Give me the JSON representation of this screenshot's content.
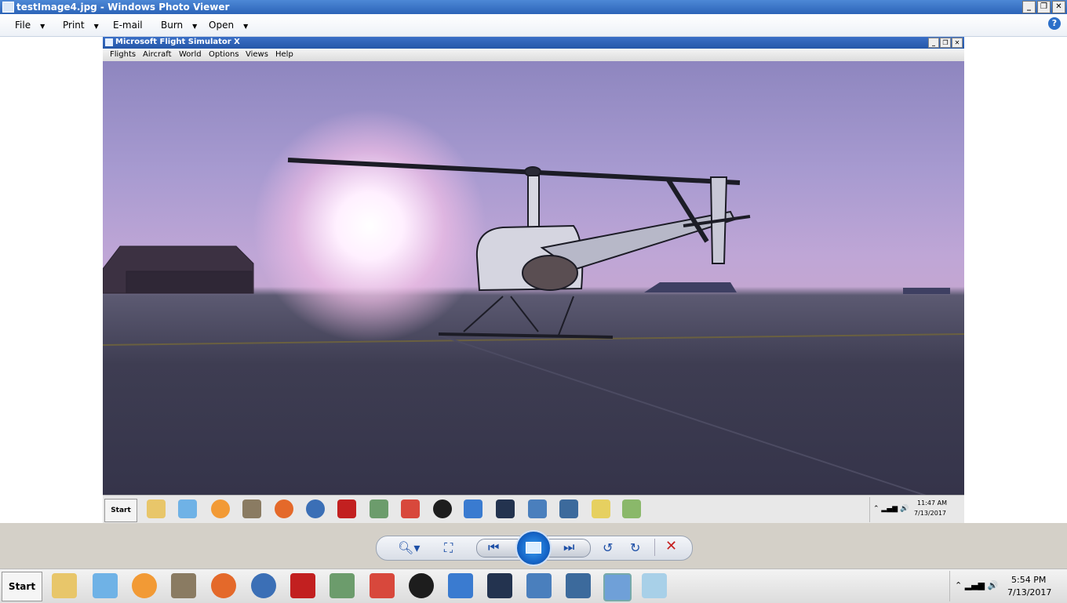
{
  "window": {
    "title": "testImage4.jpg - Windows Photo Viewer"
  },
  "menu": {
    "file": "File",
    "print": "Print",
    "email": "E-mail",
    "burn": "Burn",
    "open": "Open",
    "help": "?"
  },
  "fsx": {
    "title": "Microsoft Flight Simulator X",
    "menu": [
      "Flights",
      "Aircraft",
      "World",
      "Options",
      "Views",
      "Help"
    ]
  },
  "inner_taskbar": {
    "start": "Start",
    "time": "11:47 AM",
    "date": "7/13/2017"
  },
  "taskbar": {
    "start": "Start",
    "time": "5:54 PM",
    "date": "7/13/2017"
  },
  "colors": {
    "accent": "#1d4fa6",
    "delete": "#c62020",
    "titlebar": "#2c64b8"
  }
}
